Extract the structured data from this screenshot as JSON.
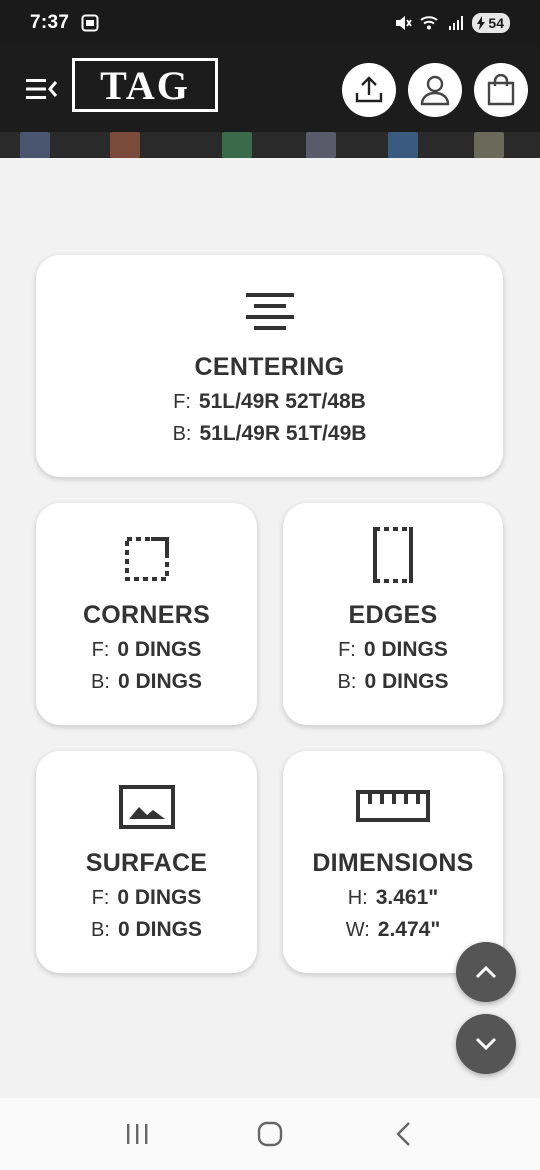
{
  "status_bar": {
    "time": "7:37",
    "battery": "54",
    "icons": [
      "screenshot-icon",
      "mute-icon",
      "wifi-icon",
      "signal-icon",
      "battery-icon"
    ]
  },
  "header": {
    "logo": "TAG",
    "buttons": [
      "menu-icon",
      "upload-icon",
      "account-icon",
      "shopping-bag-icon"
    ]
  },
  "cards": {
    "centering": {
      "title": "CENTERING",
      "icon": "align-center-icon",
      "front_label": "F:",
      "front_value": "51L/49R 52T/48B",
      "back_label": "B:",
      "back_value": "51L/49R 51T/49B"
    },
    "corners": {
      "title": "CORNERS",
      "icon": "corners-icon",
      "front_label": "F:",
      "front_value": "0 DINGS",
      "back_label": "B:",
      "back_value": "0 DINGS"
    },
    "edges": {
      "title": "EDGES",
      "icon": "edges-icon",
      "front_label": "F:",
      "front_value": "0 DINGS",
      "back_label": "B:",
      "back_value": "0 DINGS"
    },
    "surface": {
      "title": "SURFACE",
      "icon": "image-icon",
      "front_label": "F:",
      "front_value": "0 DINGS",
      "back_label": "B:",
      "back_value": "0 DINGS"
    },
    "dimensions": {
      "title": "DIMENSIONS",
      "icon": "ruler-icon",
      "height_label": "H:",
      "height_value": "3.461\"",
      "width_label": "W:",
      "width_value": "2.474\""
    }
  },
  "fabs": [
    "chevron-up-icon",
    "chevron-down-icon"
  ],
  "nav": [
    "recent-apps-icon",
    "home-icon",
    "back-icon"
  ],
  "colors": {
    "header_bg": "#1c1c1c",
    "page_bg": "#f2f2f2",
    "card_bg": "#ffffff",
    "fab_bg": "#555555",
    "text": "#333333"
  }
}
